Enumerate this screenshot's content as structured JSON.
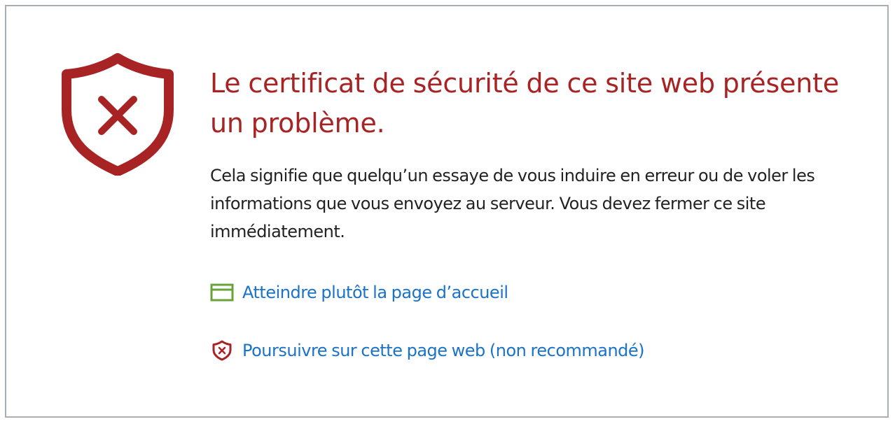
{
  "warning": {
    "title": "Le certificat de sécurité de ce site web présente un problème.",
    "description": "Cela signifie que quelqu’un essaye de vous induire en erreur ou de voler les informations que vous envoyez au serveur. Vous devez fermer ce site immédiatement.",
    "icon": "shield-x-icon"
  },
  "links": {
    "home": {
      "label": "Atteindre plutôt la page d’accueil",
      "icon": "browser-window-icon"
    },
    "continue": {
      "label": "Poursuivre sur cette page web (non recommandé)",
      "icon": "shield-x-small-icon"
    }
  },
  "colors": {
    "danger": "#a82323",
    "link": "#1a73c9",
    "home_icon": "#6aa23a",
    "text": "#222222",
    "border": "#a9b0b3"
  }
}
